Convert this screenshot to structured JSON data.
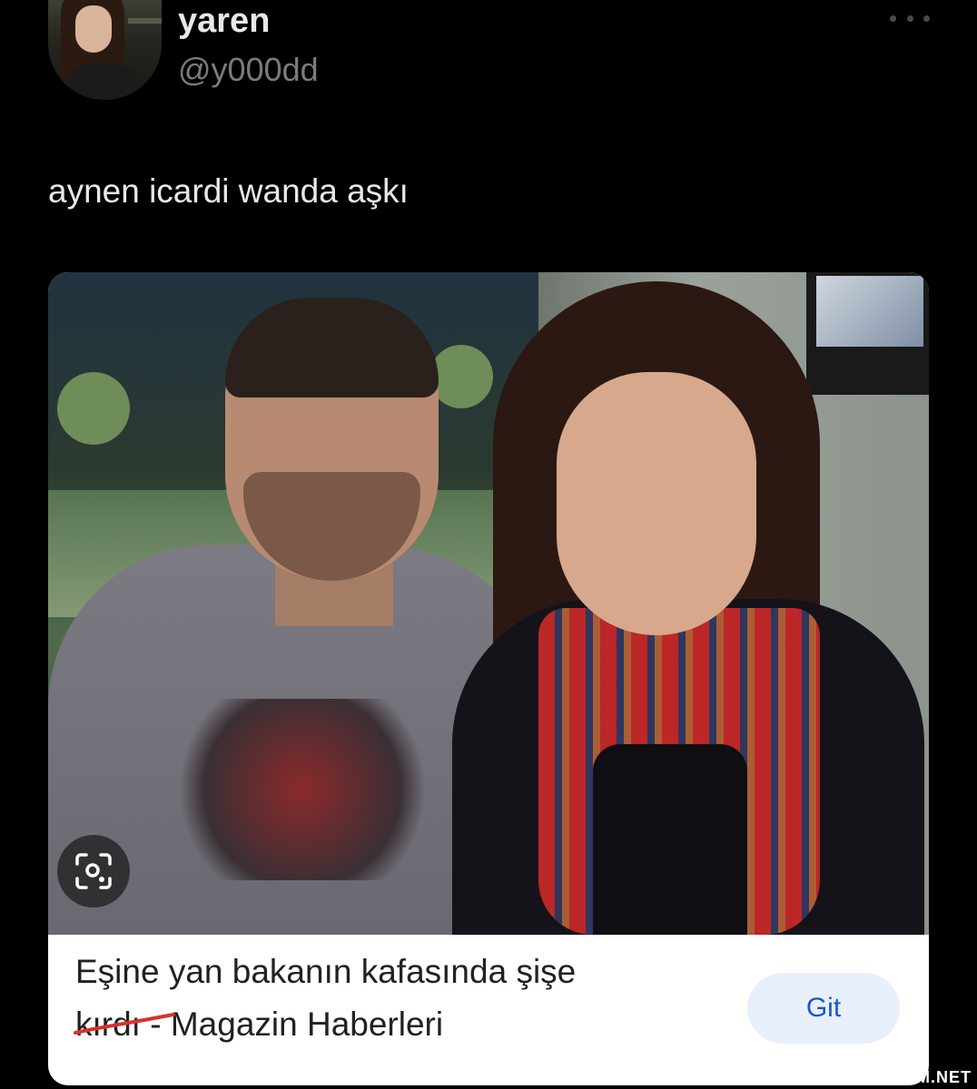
{
  "profile": {
    "name": "yaren",
    "handle": "@y000dd"
  },
  "tweet": {
    "text": "aynen icardi wanda aşkı"
  },
  "card": {
    "caption_line1": "Eşine yan bakanın kafasında şişe",
    "caption_struck": "kırdı",
    "caption_rest": " - Magazin Haberleri",
    "button_label": "Git"
  },
  "watermark": "GULDUM.NET",
  "icons": [
    "more-icon",
    "lens-icon"
  ],
  "colors": {
    "background": "#000000",
    "button_bg": "#e8f0fe",
    "button_text": "#1a57c8",
    "strike_red": "#d9312b"
  }
}
